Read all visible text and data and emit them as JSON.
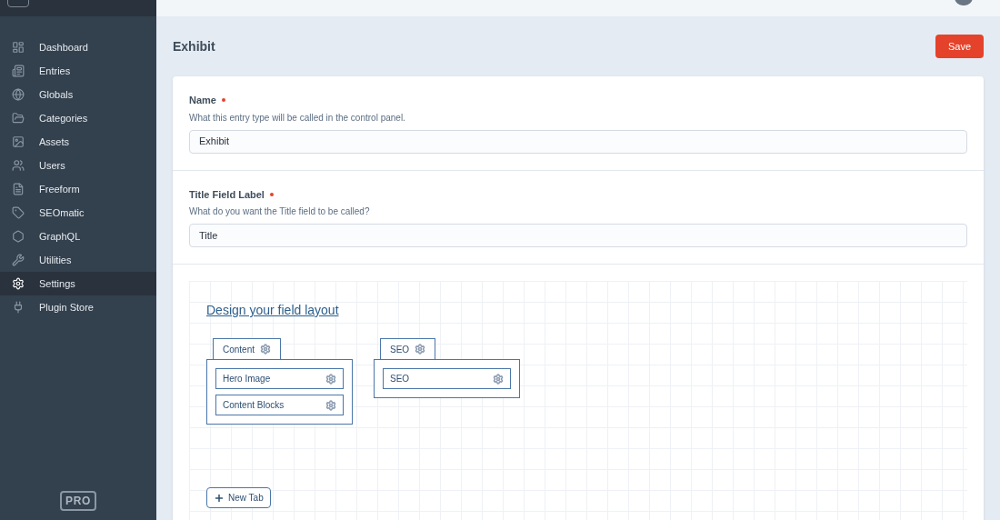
{
  "sidebar": {
    "items": [
      {
        "label": "Dashboard",
        "selected": false
      },
      {
        "label": "Entries",
        "selected": false
      },
      {
        "label": "Globals",
        "selected": false
      },
      {
        "label": "Categories",
        "selected": false
      },
      {
        "label": "Assets",
        "selected": false
      },
      {
        "label": "Users",
        "selected": false
      },
      {
        "label": "Freeform",
        "selected": false
      },
      {
        "label": "SEOmatic",
        "selected": false
      },
      {
        "label": "GraphQL",
        "selected": false
      },
      {
        "label": "Utilities",
        "selected": false
      },
      {
        "label": "Settings",
        "selected": true
      },
      {
        "label": "Plugin Store",
        "selected": false
      }
    ],
    "edition_badge": "PRO"
  },
  "page": {
    "title": "Exhibit",
    "save_button": "Save"
  },
  "fields": [
    {
      "label": "Name",
      "required": true,
      "instructions": "What this entry type will be called in the control panel.",
      "value": "Exhibit"
    },
    {
      "label": "Title Field Label",
      "required": true,
      "instructions": "What do you want the Title field to be called?",
      "value": "Title"
    }
  ],
  "field_layout": {
    "heading": "Design your field layout",
    "tabs": [
      {
        "name": "Content",
        "fields": [
          "Hero Image",
          "Content Blocks"
        ]
      },
      {
        "name": "SEO",
        "fields": [
          "SEO"
        ]
      }
    ],
    "new_tab_button": "New Tab"
  }
}
